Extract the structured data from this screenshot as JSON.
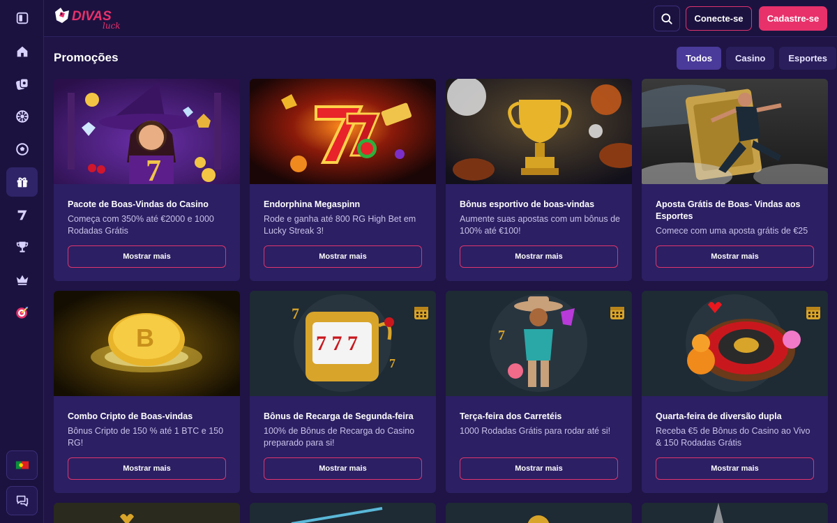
{
  "brand": {
    "logo_text": "DIVAS",
    "logo_sub": "luck",
    "accent": "#e8316b"
  },
  "header": {
    "login_label": "Conecte-se",
    "signup_label": "Cadastre-se"
  },
  "sidebar": {
    "items": [
      {
        "icon": "collapse-sidebar-icon"
      },
      {
        "icon": "home-icon"
      },
      {
        "icon": "casino-chips-icon"
      },
      {
        "icon": "live-casino-wheel-icon"
      },
      {
        "icon": "sports-football-icon"
      },
      {
        "icon": "gift-promotions-icon",
        "active": true
      },
      {
        "icon": "lucky-seven-icon"
      },
      {
        "icon": "trophy-icon"
      },
      {
        "icon": "crown-vip-icon"
      },
      {
        "icon": "target-bonus-icon"
      },
      {
        "icon": "portugal-flag-icon"
      },
      {
        "icon": "chat-support-icon"
      }
    ]
  },
  "page": {
    "title": "Promoções",
    "filters": [
      "Todos",
      "Casino",
      "Esportes"
    ],
    "active_filter": "Todos"
  },
  "promotions": [
    {
      "title": "Pacote de Boas-Vindas do Casino",
      "desc": "Começa com 350% até €2000 e 1000 Rodadas Grátis",
      "button": "Mostrar mais",
      "image": "witch-slot"
    },
    {
      "title": "Endorphina Megaspinn",
      "desc": "Rode e ganha até 800 RG High Bet em Lucky Streak 3!",
      "button": "Mostrar mais",
      "image": "lucky-seven"
    },
    {
      "title": "Bônus esportivo de boas-vindas",
      "desc": "Aumente suas apostas com um bônus de 100% até €100!",
      "button": "Mostrar mais",
      "image": "trophy-balls"
    },
    {
      "title": "Aposta Grátis de Boas- Vindas aos Esportes",
      "desc": "Comece com uma aposta grátis de €25",
      "button": "Mostrar mais",
      "image": "football-player"
    },
    {
      "title": "Combo Cripto de Boas-vindas",
      "desc": "Bônus Cripto de 150 % até 1 BTC e 150 RG!",
      "button": "Mostrar mais",
      "image": "bitcoin"
    },
    {
      "title": "Bônus de Recarga de Segunda-feira",
      "desc": "100% de Bônus de Recarga do Casino preparado para si!",
      "button": "Mostrar mais",
      "image": "slot-machine"
    },
    {
      "title": "Terça-feira dos Carretéis",
      "desc": "1000 Rodadas Grátis para rodar até si!",
      "button": "Mostrar mais",
      "image": "cowboy"
    },
    {
      "title": "Quarta-feira de diversão dupla",
      "desc": "Receba €5 de Bônus do Casino ao Vivo & 150 Rodadas Grátis",
      "button": "Mostrar mais",
      "image": "roulette"
    }
  ]
}
